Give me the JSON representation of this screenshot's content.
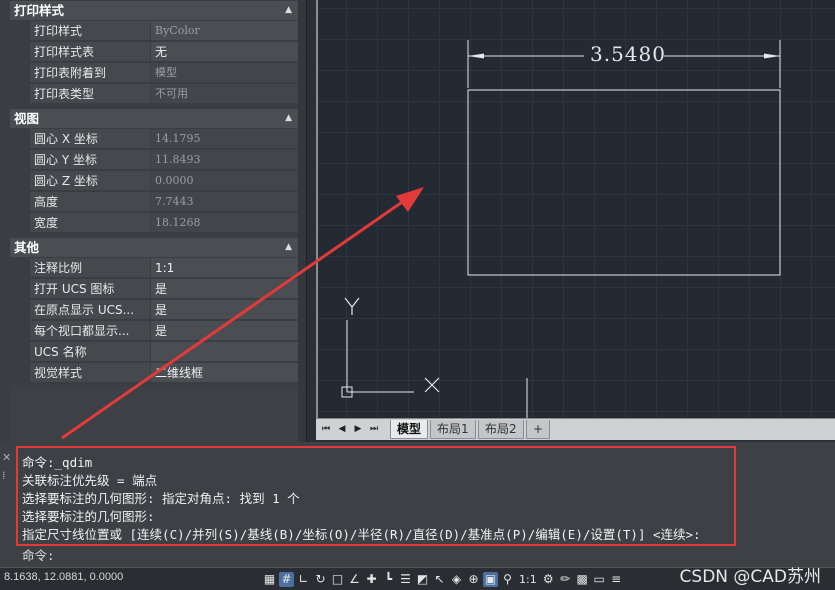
{
  "properties": {
    "sections": [
      {
        "title": "打印样式",
        "rows": [
          {
            "key": "打印样式",
            "value": "ByColor"
          },
          {
            "key": "打印样式表",
            "value": "无"
          },
          {
            "key": "打印表附着到",
            "value": "模型"
          },
          {
            "key": "打印表类型",
            "value": "不可用"
          }
        ]
      },
      {
        "title": "视图",
        "rows": [
          {
            "key": "圆心 X 坐标",
            "value": "14.1795"
          },
          {
            "key": "圆心 Y 坐标",
            "value": "11.8493"
          },
          {
            "key": "圆心 Z 坐标",
            "value": "0.0000"
          },
          {
            "key": "高度",
            "value": "7.7443"
          },
          {
            "key": "宽度",
            "value": "18.1268"
          }
        ]
      },
      {
        "title": "其他",
        "rows": [
          {
            "key": "注释比例",
            "value": "1:1"
          },
          {
            "key": "打开 UCS 图标",
            "value": "是"
          },
          {
            "key": "在原点显示 UCS...",
            "value": "是"
          },
          {
            "key": "每个视口都显示...",
            "value": "是"
          },
          {
            "key": "UCS 名称",
            "value": ""
          },
          {
            "key": "视觉样式",
            "value": "二维线框"
          }
        ]
      }
    ]
  },
  "drawing": {
    "dimension_text": "3.5480",
    "ucs_x_label": "X",
    "ucs_y_label": "Y"
  },
  "tabs": {
    "items": [
      "模型",
      "布局1",
      "布局2"
    ],
    "add": "+",
    "nav": [
      "⏮",
      "◀",
      "▶",
      "⏭"
    ]
  },
  "command": {
    "history": [
      "命令:_qdim",
      "关联标注优先级 = 端点",
      "选择要标注的几何图形: 指定对角点: 找到 1 个",
      "选择要标注的几何图形:",
      "指定尺寸线位置或 [连续(C)/并列(S)/基线(B)/坐标(O)/半径(R)/直径(D)/基准点(P)/编辑(E)/设置(T)] <连续>:"
    ],
    "prompt": "命令:",
    "close_glyph": "✕",
    "grip_glyph": "⁞"
  },
  "status": {
    "coords": "8.1638, 12.0881, 0.0000",
    "scale": "1:1",
    "watermark": "CSDN @CAD苏州",
    "icons": [
      "grid-display-icon",
      "snap-grid-icon",
      "ortho-icon",
      "polar-icon",
      "object-snap-icon",
      "angle-icon",
      "osnap-track-icon",
      "ucs-icon",
      "lineweight-icon",
      "transparency-icon",
      "selection-cycling-icon",
      "3d-osnap-icon",
      "annotation-monitor-icon",
      "workspace-icon",
      "annotation-visibility-icon",
      "annotation-scale-icon",
      "settings-gear-icon",
      "isolate-icon",
      "hardware-accel-icon",
      "clean-screen-icon",
      "customize-icon"
    ]
  },
  "colors": {
    "highlight": "#e23a3a",
    "viewport_bg": "#242a33"
  }
}
